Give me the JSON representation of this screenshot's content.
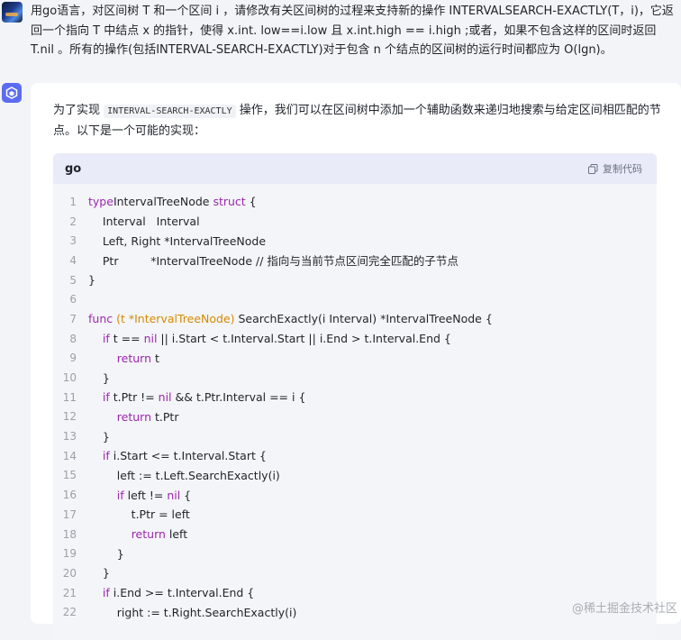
{
  "user": {
    "message": "用go语言，对区间树 T 和一个区间 i ，请修改有关区间树的过程来支持新的操作 INTERVALSEARCH-EXACTLY(T，i)，它返回一个指向 T 中结点 x 的指针，使得 x.int. low==i.low 且 x.int.high == i.high ;或者，如果不包含这样的区间时返回 T.nil 。所有的操作(包括INTERVAL-SEARCH-EXACTLY)对于包含 n 个结点的区间树的运行时间都应为 O(lgn)。"
  },
  "answer": {
    "intro_before": "为了实现 ",
    "intro_code": "INTERVAL-SEARCH-EXACTLY",
    "intro_after": " 操作，我们可以在区间树中添加一个辅助函数来递归地搜索与给定区间相匹配的节点。以下是一个可能的实现：",
    "code": {
      "language": "go",
      "copy_label": "复制代码",
      "lines": [
        {
          "n": "1",
          "segs": [
            [
              "kw",
              "type"
            ],
            [
              "",
              "IntervalTreeNode "
            ],
            [
              "kw",
              "struct"
            ],
            [
              "",
              " {"
            ]
          ]
        },
        {
          "n": "2",
          "segs": [
            [
              "",
              "    Interval   Interval"
            ]
          ]
        },
        {
          "n": "3",
          "segs": [
            [
              "",
              "    Left, Right *IntervalTreeNode"
            ]
          ]
        },
        {
          "n": "4",
          "segs": [
            [
              "",
              "    Ptr         *IntervalTreeNode // 指向与当前节点区间完全匹配的子节点"
            ]
          ]
        },
        {
          "n": "5",
          "segs": [
            [
              "",
              "}"
            ]
          ]
        },
        {
          "n": "6",
          "segs": []
        },
        {
          "n": "7",
          "segs": [
            [
              "kw",
              "func"
            ],
            [
              "fn",
              " (t *IntervalTreeNode)"
            ],
            [
              "",
              " SearchExactly(i Interval) *IntervalTreeNode {"
            ]
          ]
        },
        {
          "n": "8",
          "segs": [
            [
              "",
              "    "
            ],
            [
              "kw",
              "if"
            ],
            [
              "",
              " t == "
            ],
            [
              "kw",
              "nil"
            ],
            [
              "",
              " || i.Start < t.Interval.Start || i.End > t.Interval.End {"
            ]
          ]
        },
        {
          "n": "9",
          "segs": [
            [
              "",
              "        "
            ],
            [
              "kw",
              "return"
            ],
            [
              "",
              " t"
            ]
          ]
        },
        {
          "n": "10",
          "segs": [
            [
              "",
              "    }"
            ]
          ]
        },
        {
          "n": "11",
          "segs": [
            [
              "",
              "    "
            ],
            [
              "kw",
              "if"
            ],
            [
              "",
              " t.Ptr != "
            ],
            [
              "kw",
              "nil"
            ],
            [
              "",
              " && t.Ptr.Interval == i {"
            ]
          ]
        },
        {
          "n": "12",
          "segs": [
            [
              "",
              "        "
            ],
            [
              "kw",
              "return"
            ],
            [
              "",
              " t.Ptr"
            ]
          ]
        },
        {
          "n": "13",
          "segs": [
            [
              "",
              "    }"
            ]
          ]
        },
        {
          "n": "14",
          "segs": [
            [
              "",
              "    "
            ],
            [
              "kw",
              "if"
            ],
            [
              "",
              " i.Start <= t.Interval.Start {"
            ]
          ]
        },
        {
          "n": "15",
          "segs": [
            [
              "",
              "        left := t.Left.SearchExactly(i)"
            ]
          ]
        },
        {
          "n": "16",
          "segs": [
            [
              "",
              "        "
            ],
            [
              "kw",
              "if"
            ],
            [
              "",
              " left != "
            ],
            [
              "kw",
              "nil"
            ],
            [
              "",
              " {"
            ]
          ]
        },
        {
          "n": "17",
          "segs": [
            [
              "",
              "            t.Ptr = left"
            ]
          ]
        },
        {
          "n": "18",
          "segs": [
            [
              "",
              "            "
            ],
            [
              "kw",
              "return"
            ],
            [
              "",
              " left"
            ]
          ]
        },
        {
          "n": "19",
          "segs": [
            [
              "",
              "        }"
            ]
          ]
        },
        {
          "n": "20",
          "segs": [
            [
              "",
              "    }"
            ]
          ]
        },
        {
          "n": "21",
          "segs": [
            [
              "",
              "    "
            ],
            [
              "kw",
              "if"
            ],
            [
              "",
              " i.End >= t.Interval.End {"
            ]
          ]
        },
        {
          "n": "22",
          "segs": [
            [
              "",
              "        right := t.Right.SearchExactly(i)"
            ]
          ]
        }
      ]
    }
  },
  "watermark": "@稀土掘金技术社区",
  "icons": {
    "user_avatar": "user-avatar-image",
    "bot_avatar": "cube-icon",
    "copy": "copy-icon"
  }
}
